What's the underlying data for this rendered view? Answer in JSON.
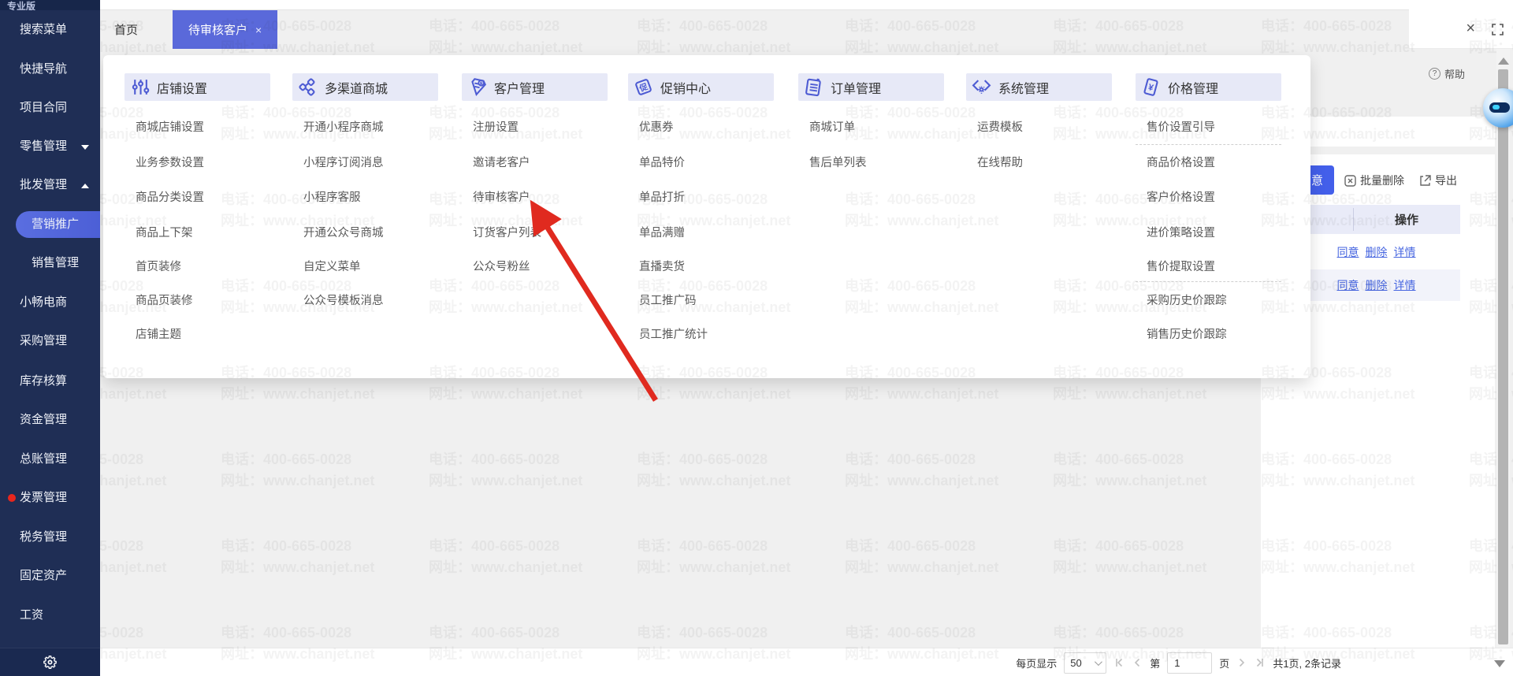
{
  "app": {
    "edition_label": "专业版",
    "help_label": "帮助"
  },
  "colors": {
    "accent": "#5a69da",
    "sidebar_bg": "#1f2e55",
    "active_item": "#5266d9",
    "link_blue": "#4766e0",
    "arrow_red": "#e02a1f",
    "header_band": "#e7e9f7",
    "button_blue": "#435fea"
  },
  "tabs": {
    "home": "首页",
    "active": "待审核客户",
    "close_glyph": "×"
  },
  "sidebar": {
    "items": [
      {
        "label": "搜索菜单",
        "indent": 1
      },
      {
        "label": "快捷导航",
        "indent": 1
      },
      {
        "label": "项目合同",
        "indent": 1
      },
      {
        "label": "零售管理",
        "indent": 1,
        "chevron": "down"
      },
      {
        "label": "批发管理",
        "indent": 1,
        "chevron": "up"
      },
      {
        "label": "营销推广",
        "indent": 2,
        "active": true
      },
      {
        "label": "销售管理",
        "indent": 2
      },
      {
        "label": "小畅电商",
        "indent": 1
      },
      {
        "label": "采购管理",
        "indent": 1
      },
      {
        "label": "库存核算",
        "indent": 1
      },
      {
        "label": "资金管理",
        "indent": 1
      },
      {
        "label": "总账管理",
        "indent": 1
      },
      {
        "label": "发票管理",
        "indent": 1,
        "dot": true
      },
      {
        "label": "税务管理",
        "indent": 1
      },
      {
        "label": "固定资产",
        "indent": 1
      },
      {
        "label": "工资",
        "indent": 1
      }
    ]
  },
  "mega_menu": {
    "sections": [
      {
        "title": "店铺设置",
        "icon": "tune-icon",
        "items": [
          "商城店铺设置",
          "业务参数设置",
          "商品分类设置",
          "商品上下架",
          "首页装修",
          "商品页装修",
          "店铺主题"
        ]
      },
      {
        "title": "多渠道商城",
        "icon": "channels-icon",
        "items": [
          "开通小程序商城",
          "小程序订阅消息",
          "小程序客服",
          "开通公众号商城",
          "自定义菜单",
          "公众号模板消息"
        ]
      },
      {
        "title": "客户管理",
        "icon": "customer-icon",
        "items": [
          "注册设置",
          "邀请老客户",
          "待审核客户",
          "订货客户列表",
          "公众号粉丝"
        ]
      },
      {
        "title": "促销中心",
        "icon": "promo-icon",
        "items": [
          "优惠券",
          "单品特价",
          "单品打折",
          "单品满赠",
          "直播卖货",
          "员工推广码",
          "员工推广统计"
        ]
      },
      {
        "title": "订单管理",
        "icon": "order-icon",
        "items": [
          "商城订单",
          "售后单列表"
        ]
      },
      {
        "title": "系统管理",
        "icon": "system-icon",
        "items": [
          "运费模板",
          "在线帮助"
        ]
      },
      {
        "title": "价格管理",
        "icon": "price-icon",
        "items": [
          "售价设置引导",
          "商品价格设置",
          "客户价格设置",
          "进价策略设置",
          "售价提取设置",
          "采购历史价跟踪",
          "销售历史价跟踪"
        ],
        "dividers_after": [
          0,
          4
        ]
      }
    ]
  },
  "watermark": {
    "line1": "电话：400-665-0028",
    "line2": "网址：www.chanjet.net"
  },
  "content_right": {
    "agree_button_visible": "意",
    "batch_delete_label": "批量删除",
    "export_label": "导出",
    "op_header": "操作",
    "rows": [
      [
        "同意",
        "删除",
        "详情"
      ],
      [
        "同意",
        "删除",
        "详情"
      ]
    ]
  },
  "pagination": {
    "per_page_label": "每页显示",
    "per_page_value": "50",
    "page_prefix": "第",
    "page_value": "1",
    "page_suffix": "页",
    "summary": "共1页, 2条记录"
  }
}
